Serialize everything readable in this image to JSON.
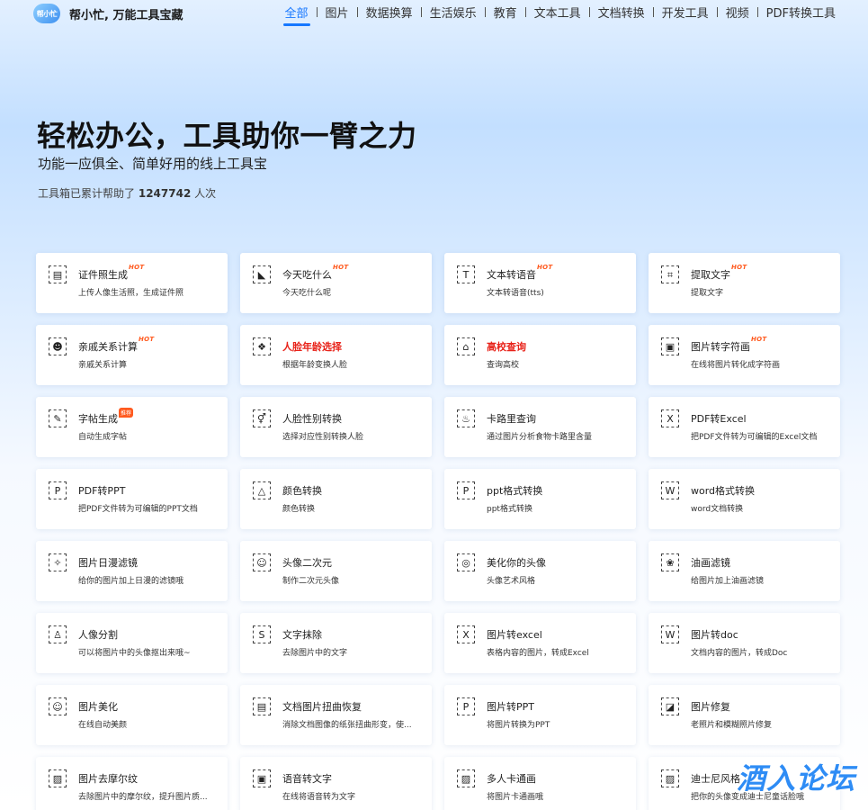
{
  "header": {
    "logo_mark": "帮小忙",
    "site_name": "帮小忙, 万能工具宝藏",
    "nav": [
      "全部",
      "图片",
      "数据换算",
      "生活娱乐",
      "教育",
      "文本工具",
      "文档转换",
      "开发工具",
      "视频",
      "PDF转换工具"
    ],
    "active_nav": "全部"
  },
  "hero": {
    "title": "轻松办公，工具助你一臂之力",
    "subtitle": "功能一应俱全、简单好用的线上工具宝",
    "count_prefix": "工具箱已累计帮助了",
    "count_value": "1247742",
    "count_suffix": "人次"
  },
  "badges": {
    "hot": "HOT",
    "recommend": "推荐"
  },
  "tools": [
    {
      "title": "证件照生成",
      "desc": "上传人像生活照，生成证件照",
      "badge": "hot",
      "icon": "id-card-icon",
      "glyph": "▤"
    },
    {
      "title": "今天吃什么",
      "desc": "今天吃什么呢",
      "badge": "hot",
      "icon": "food-icon",
      "glyph": "◣"
    },
    {
      "title": "文本转语音",
      "desc": "文本转语音(tts)",
      "badge": "hot",
      "icon": "text-speech-icon",
      "glyph": "T"
    },
    {
      "title": "提取文字",
      "desc": "提取文字",
      "badge": "hot",
      "icon": "ocr-icon",
      "glyph": "⌗"
    },
    {
      "title": "亲戚关系计算",
      "desc": "亲戚关系计算",
      "badge": "hot",
      "icon": "relatives-icon",
      "glyph": "☻"
    },
    {
      "title": "人脸年龄选择",
      "desc": "根据年龄变换人脸",
      "badge": "",
      "icon": "face-age-icon",
      "glyph": "❖",
      "red": true
    },
    {
      "title": "高校查询",
      "desc": "查询高校",
      "badge": "",
      "icon": "university-icon",
      "glyph": "⌂",
      "red": true
    },
    {
      "title": "图片转字符画",
      "desc": "在线将图片转化成字符画",
      "badge": "hot",
      "icon": "char-art-icon",
      "glyph": "▣"
    },
    {
      "title": "字帖生成",
      "desc": "自动生成字帖",
      "badge": "recommend",
      "icon": "copybook-icon",
      "glyph": "✎"
    },
    {
      "title": "人脸性别转换",
      "desc": "选择对应性别转换人脸",
      "badge": "",
      "icon": "gender-icon",
      "glyph": "⚥"
    },
    {
      "title": "卡路里查询",
      "desc": "通过图片分析食物卡路里含量",
      "badge": "",
      "icon": "calorie-icon",
      "glyph": "♨"
    },
    {
      "title": "PDF转Excel",
      "desc": "把PDF文件转为可编辑的Excel文档",
      "badge": "",
      "icon": "pdf-excel-icon",
      "glyph": "X"
    },
    {
      "title": "PDF转PPT",
      "desc": "把PDF文件转为可编辑的PPT文档",
      "badge": "",
      "icon": "pdf-ppt-icon",
      "glyph": "P"
    },
    {
      "title": "颜色转换",
      "desc": "颜色转换",
      "badge": "",
      "icon": "color-icon",
      "glyph": "△"
    },
    {
      "title": "ppt格式转换",
      "desc": "ppt格式转换",
      "badge": "",
      "icon": "ppt-format-icon",
      "glyph": "P"
    },
    {
      "title": "word格式转换",
      "desc": "word文档转换",
      "badge": "",
      "icon": "word-format-icon",
      "glyph": "W"
    },
    {
      "title": "图片日漫滤镜",
      "desc": "给你的图片加上日漫的滤镜哦",
      "badge": "",
      "icon": "anime-filter-icon",
      "glyph": "✧"
    },
    {
      "title": "头像二次元",
      "desc": "制作二次元头像",
      "badge": "",
      "icon": "anime-avatar-icon",
      "glyph": "☺"
    },
    {
      "title": "美化你的头像",
      "desc": "头像艺术风格",
      "badge": "",
      "icon": "beautify-avatar-icon",
      "glyph": "◎"
    },
    {
      "title": "油画滤镜",
      "desc": "给图片加上油画滤镜",
      "badge": "",
      "icon": "oil-painting-icon",
      "glyph": "❀"
    },
    {
      "title": "人像分割",
      "desc": "可以将图片中的头像抠出来哦~",
      "badge": "",
      "icon": "portrait-cut-icon",
      "glyph": "♙"
    },
    {
      "title": "文字抹除",
      "desc": "去除图片中的文字",
      "badge": "",
      "icon": "text-erase-icon",
      "glyph": "S"
    },
    {
      "title": "图片转excel",
      "desc": "表格内容的图片，转成Excel",
      "badge": "",
      "icon": "img-excel-icon",
      "glyph": "X"
    },
    {
      "title": "图片转doc",
      "desc": "文档内容的图片，转成Doc",
      "badge": "",
      "icon": "img-doc-icon",
      "glyph": "W"
    },
    {
      "title": "图片美化",
      "desc": "在线自动美颜",
      "badge": "",
      "icon": "img-beautify-icon",
      "glyph": "☺"
    },
    {
      "title": "文档图片扭曲恢复",
      "desc": "消除文档图像的纸张扭曲形变，使...",
      "badge": "",
      "icon": "doc-dewarp-icon",
      "glyph": "▤"
    },
    {
      "title": "图片转PPT",
      "desc": "将图片转换为PPT",
      "badge": "",
      "icon": "img-ppt-icon",
      "glyph": "P"
    },
    {
      "title": "图片修复",
      "desc": "老照片和模糊照片修复",
      "badge": "",
      "icon": "img-repair-icon",
      "glyph": "◪"
    },
    {
      "title": "图片去摩尔纹",
      "desc": "去除图片中的摩尔纹，提升图片质...",
      "badge": "",
      "icon": "moire-icon",
      "glyph": "▨"
    },
    {
      "title": "语音转文字",
      "desc": "在线将语音转为文字",
      "badge": "",
      "icon": "speech-text-icon",
      "glyph": "▣"
    },
    {
      "title": "多人卡通画",
      "desc": "将图片卡通画哦",
      "badge": "",
      "icon": "cartoon-icon",
      "glyph": "▨"
    },
    {
      "title": "迪士尼风格",
      "desc": "把你的头像变成迪士尼童话脸哦",
      "badge": "",
      "icon": "disney-icon",
      "glyph": "▨"
    }
  ],
  "watermark": "酒入论坛"
}
